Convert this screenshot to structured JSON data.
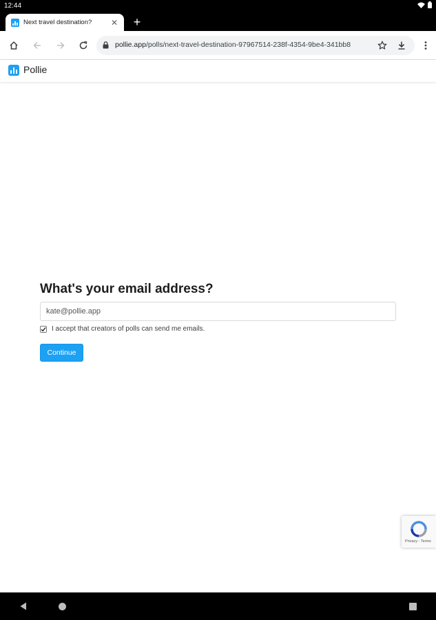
{
  "status_bar": {
    "time": "12:44"
  },
  "browser": {
    "tab_title": "Next travel destination?",
    "url_domain": "pollie.app",
    "url_path": "/polls/next-travel-destination-97967514-238f-4354-9be4-341bb8"
  },
  "site": {
    "name": "Pollie"
  },
  "form": {
    "title": "What's your email address?",
    "email_value": "kate@pollie.app",
    "consent_label": "I accept that creators of polls can send me emails.",
    "consent_checked": true,
    "continue_label": "Continue"
  },
  "recaptcha": {
    "privacy_terms": "Privacy - Terms"
  },
  "colors": {
    "accent": "#1da1f2",
    "status_bar": "#000000"
  }
}
